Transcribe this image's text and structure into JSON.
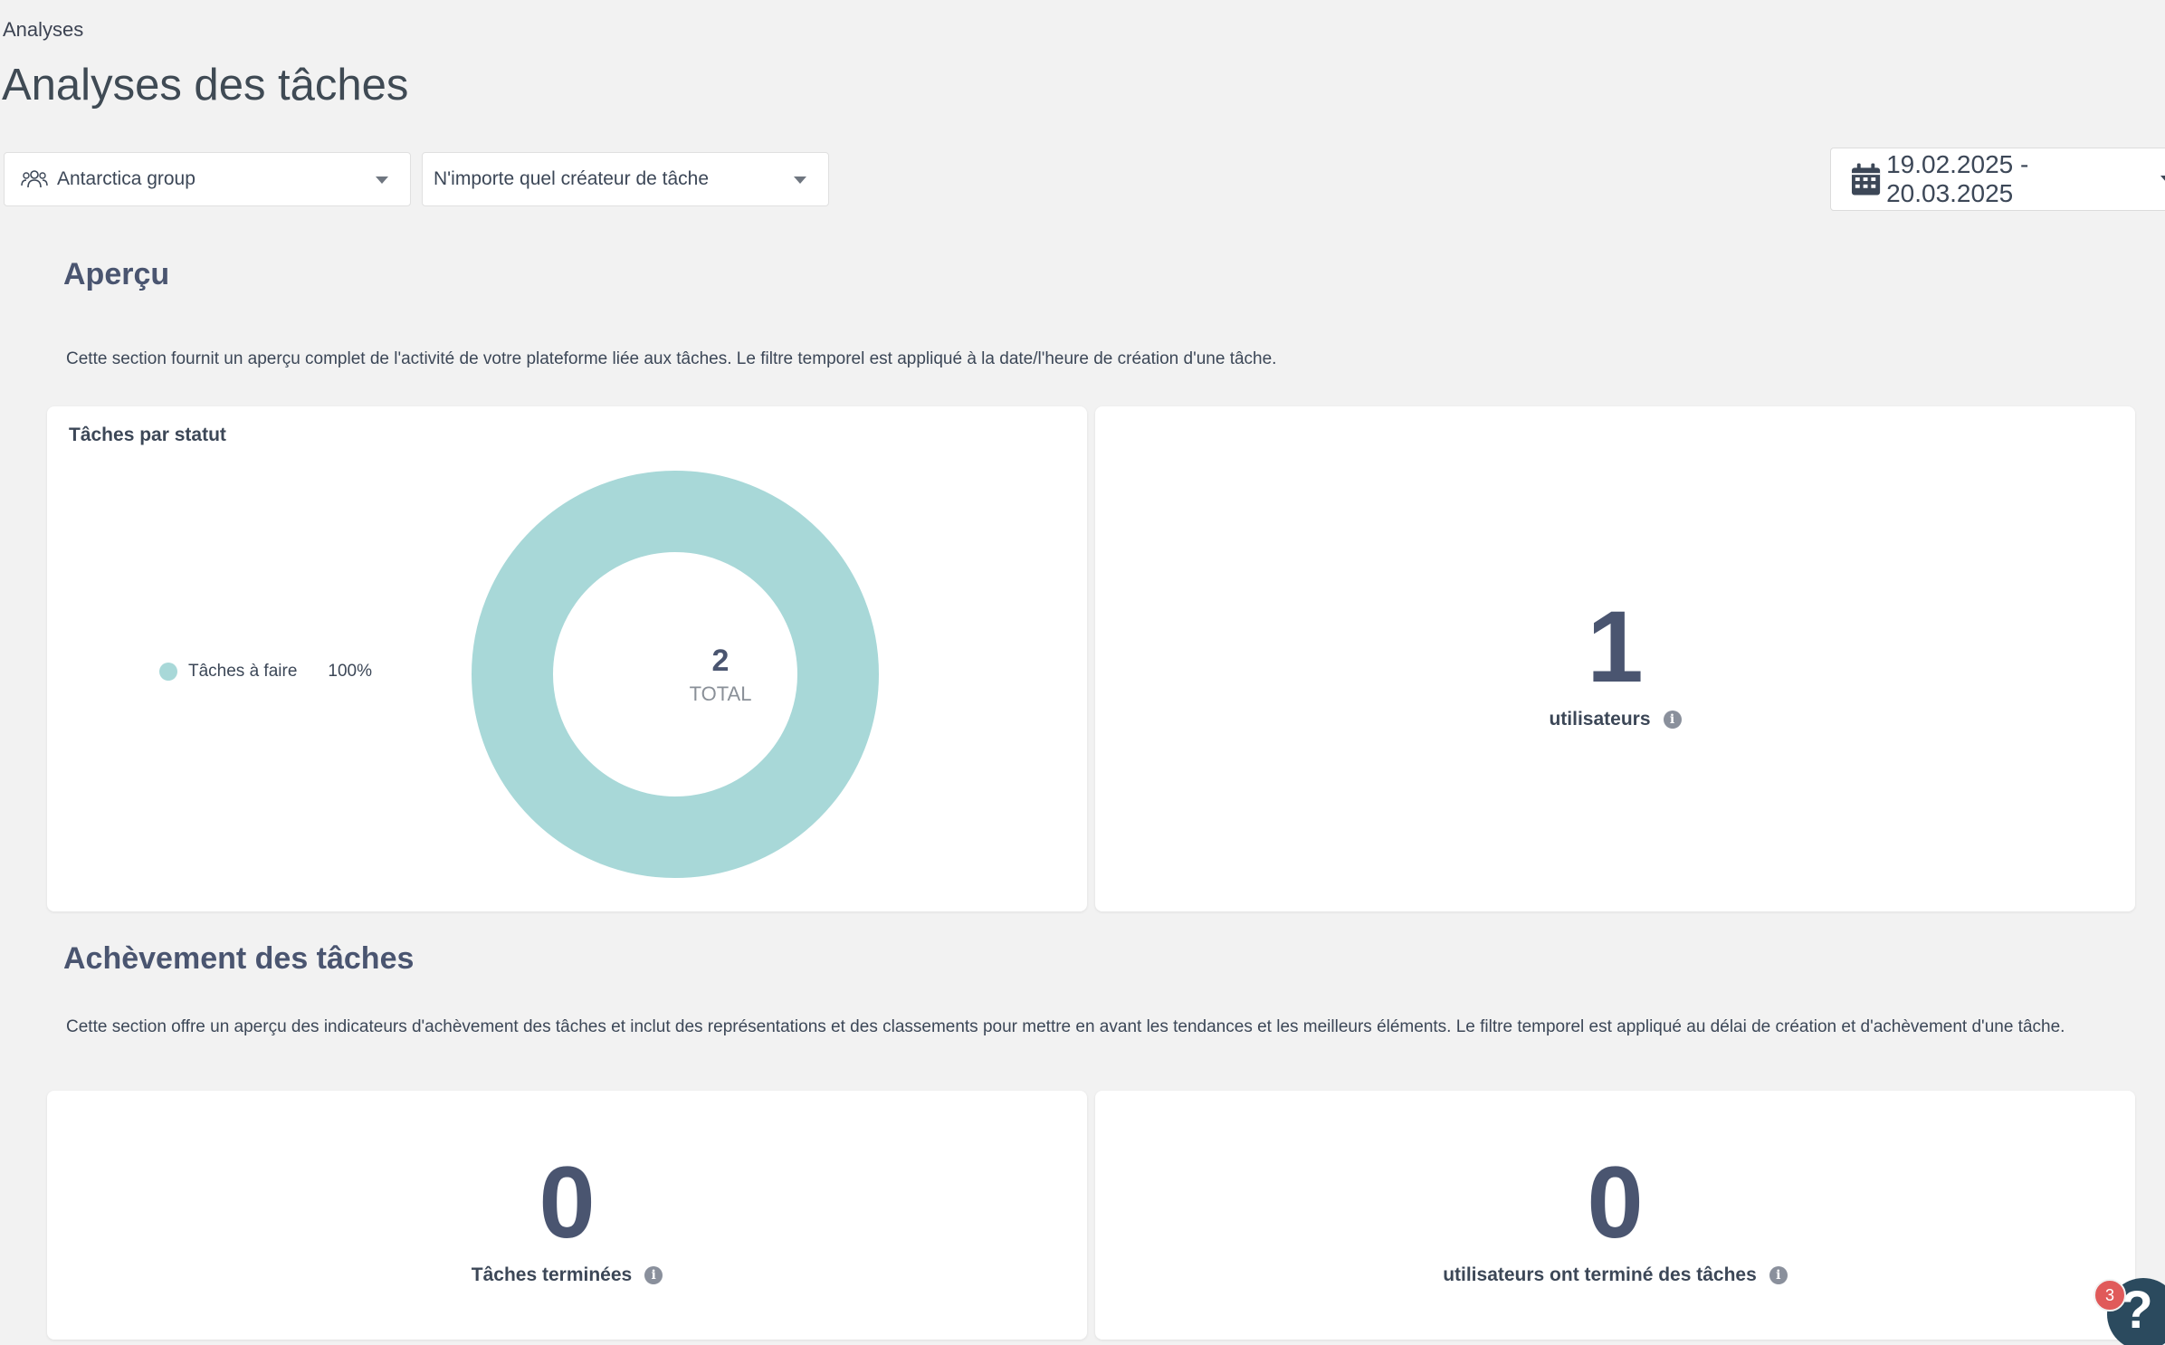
{
  "breadcrumb": "Analyses",
  "page_title": "Analyses des tâches",
  "filters": {
    "group": "Antarctica group",
    "creator": "N'importe quel créateur de tâche",
    "date_range": "19.02.2025 - 20.03.2025"
  },
  "overview": {
    "title": "Aperçu",
    "description": "Cette section fournit un aperçu complet de l'activité de votre plateforme liée aux tâches. Le filtre temporel est appliqué à la date/l'heure de création d'une tâche.",
    "status_card": {
      "title": "Tâches par statut",
      "legend": [
        {
          "label": "Tâches à faire",
          "percent": "100%",
          "color": "#a8d8d8"
        }
      ],
      "total_value": "2",
      "total_label": "TOTAL"
    },
    "users_card": {
      "value": "1",
      "label": "utilisateurs"
    }
  },
  "completion": {
    "title": "Achèvement des tâches",
    "description": "Cette section offre un aperçu des indicateurs d'achèvement des tâches et inclut des représentations et des classements pour mettre en avant les tendances et les meilleurs éléments. Le filtre temporel est appliqué au délai de création et d'achèvement d'une tâche.",
    "completed_tasks": {
      "value": "0",
      "label": "Tâches terminées"
    },
    "users_completed": {
      "value": "0",
      "label": "utilisateurs ont terminé des tâches"
    }
  },
  "help": {
    "badge_count": "3",
    "icon_label": "?"
  },
  "colors": {
    "accent_teal": "#a8d8d8",
    "heading": "#4a5570",
    "help_button": "#2b4a5e",
    "badge": "#e05a5a"
  }
}
